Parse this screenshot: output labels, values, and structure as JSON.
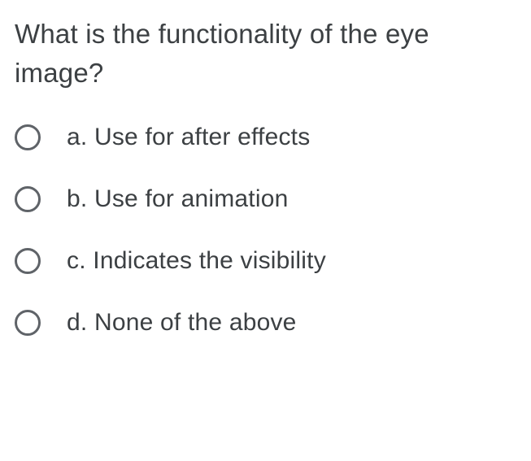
{
  "question": "What is the functionality of the eye image?",
  "options": [
    {
      "prefix": "a.",
      "text": "Use for after effects"
    },
    {
      "prefix": "b.",
      "text": "Use for animation"
    },
    {
      "prefix": "c.",
      "text": "Indicates the visibility"
    },
    {
      "prefix": "d.",
      "text": "None of the above"
    }
  ]
}
